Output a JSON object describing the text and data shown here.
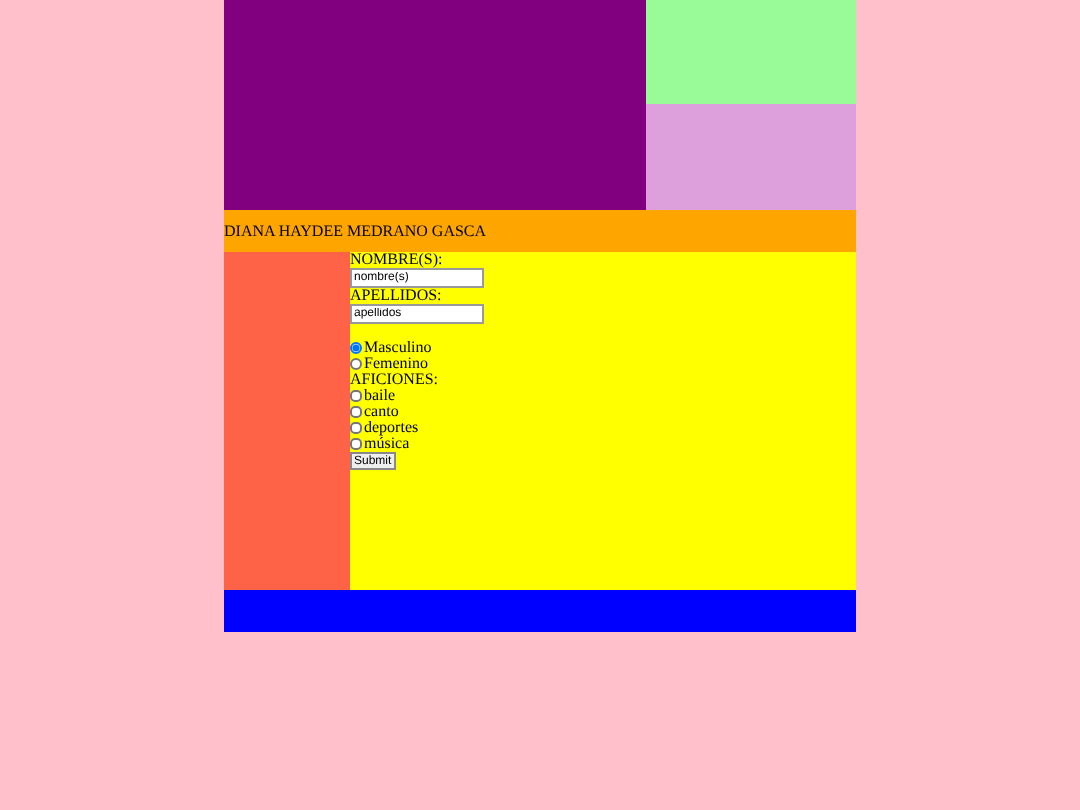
{
  "header": {
    "name": "DIANA HAYDEE MEDRANO GASCA"
  },
  "form": {
    "fields": [
      {
        "label": "NOMBRE(S):",
        "value": "nombre(s)"
      },
      {
        "label": "APELLIDOS:",
        "value": "apellidos"
      }
    ],
    "gender": [
      {
        "label": "Masculino",
        "selected": true
      },
      {
        "label": "Femenino",
        "selected": false
      }
    ],
    "hobbies_label": "AFICIONES:",
    "hobbies": [
      {
        "label": "baile",
        "checked": false
      },
      {
        "label": "canto",
        "checked": false
      },
      {
        "label": "deportes",
        "checked": false
      },
      {
        "label": "música",
        "checked": false
      }
    ],
    "submit": "Submit"
  }
}
